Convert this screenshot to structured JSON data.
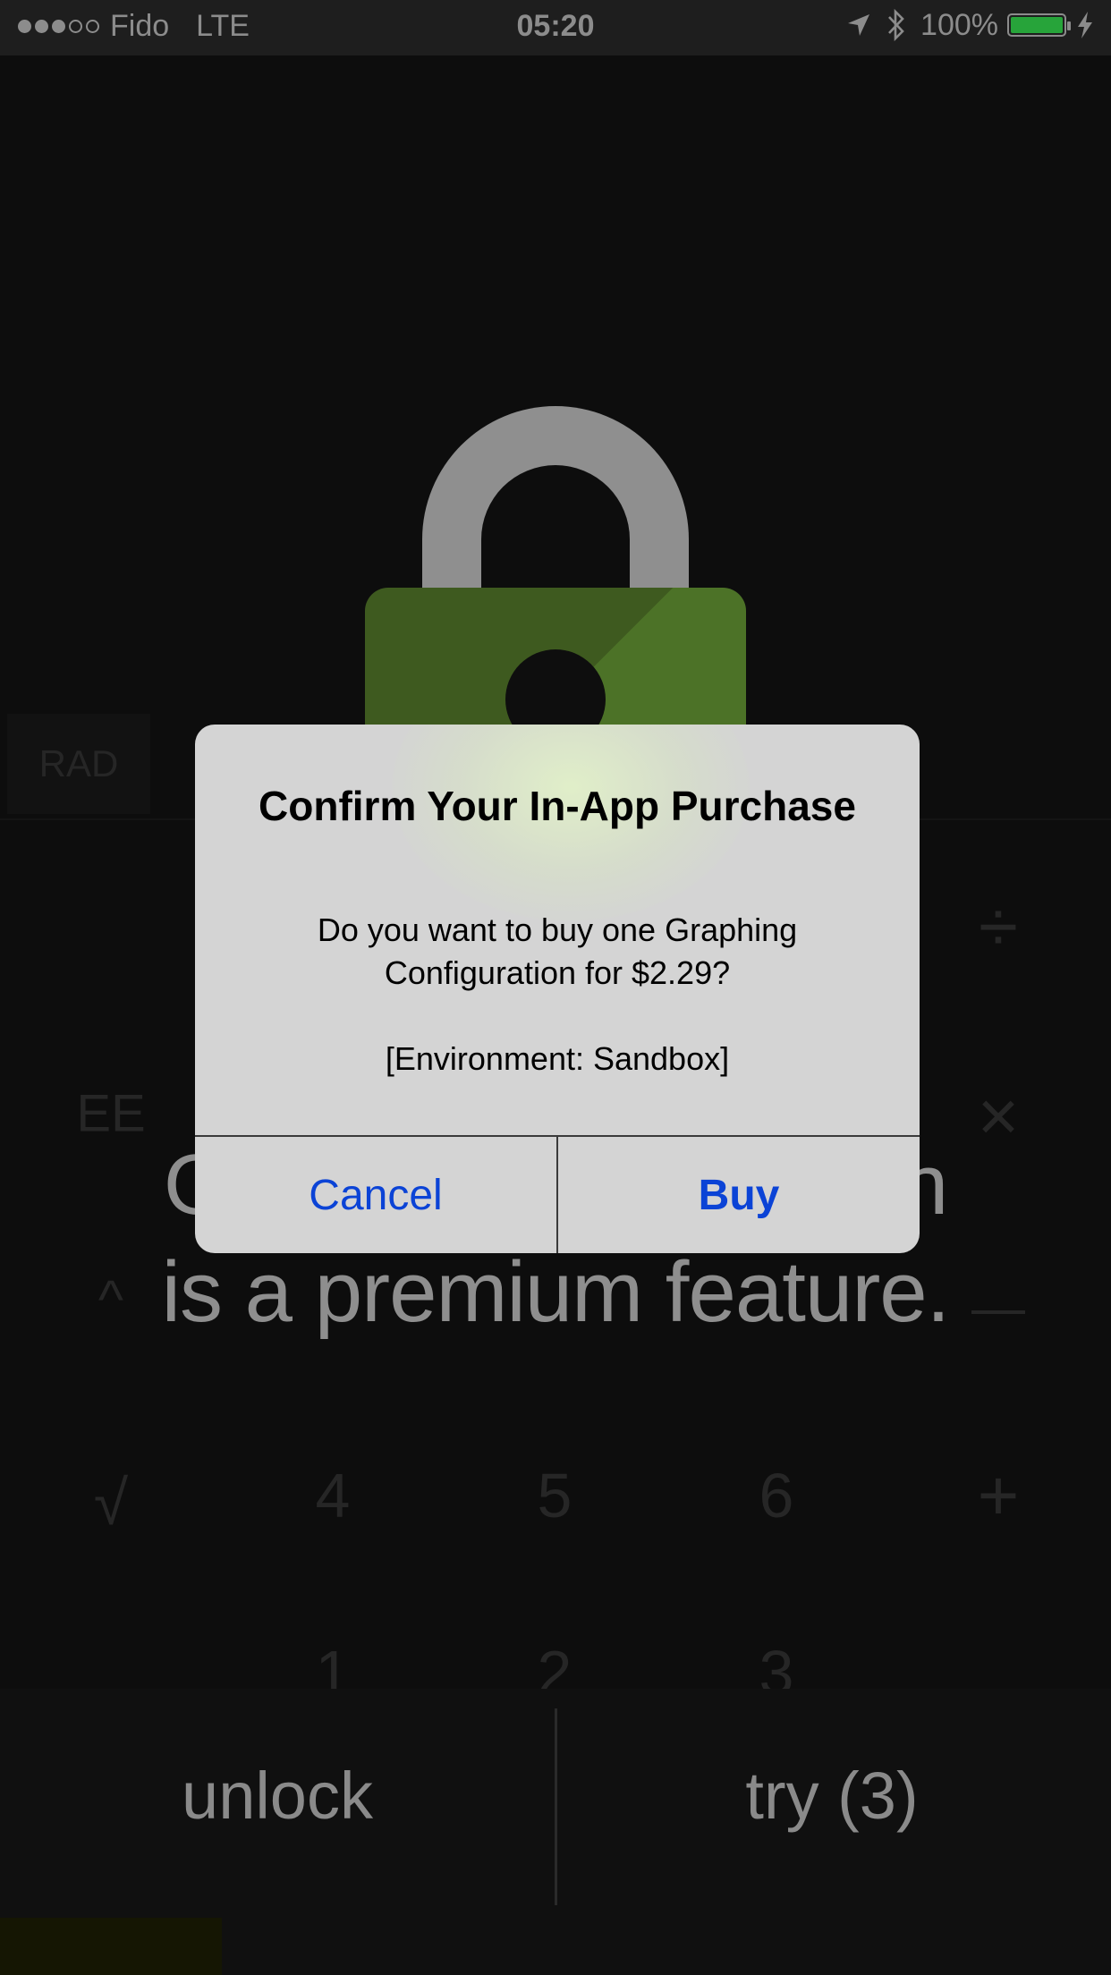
{
  "status_bar": {
    "carrier": "Fido",
    "network": "LTE",
    "time": "05:20",
    "battery": "100%",
    "battery_color": "#27a43a"
  },
  "calculator": {
    "mode": "RAD",
    "keys": {
      "ee": "EE",
      "divide": "÷",
      "multiply": "×",
      "power": "^",
      "minus": "—",
      "sqrt": "√",
      "four": "4",
      "five": "5",
      "six": "6",
      "plus": "+",
      "one": "1",
      "two": "2",
      "three": "3"
    }
  },
  "premium_notice": {
    "line1": "Graphing Calculation",
    "line2": "is a premium feature."
  },
  "bottom_bar": {
    "unlock_label": "unlock",
    "try_label": "try (3)"
  },
  "dialog": {
    "title": "Confirm Your In-App Purchase",
    "message": "Do you want to buy one Graphing Configuration for $2.29?",
    "environment": "[Environment: Sandbox]",
    "cancel_label": "Cancel",
    "buy_label": "Buy",
    "button_color": "#0b43d6"
  }
}
